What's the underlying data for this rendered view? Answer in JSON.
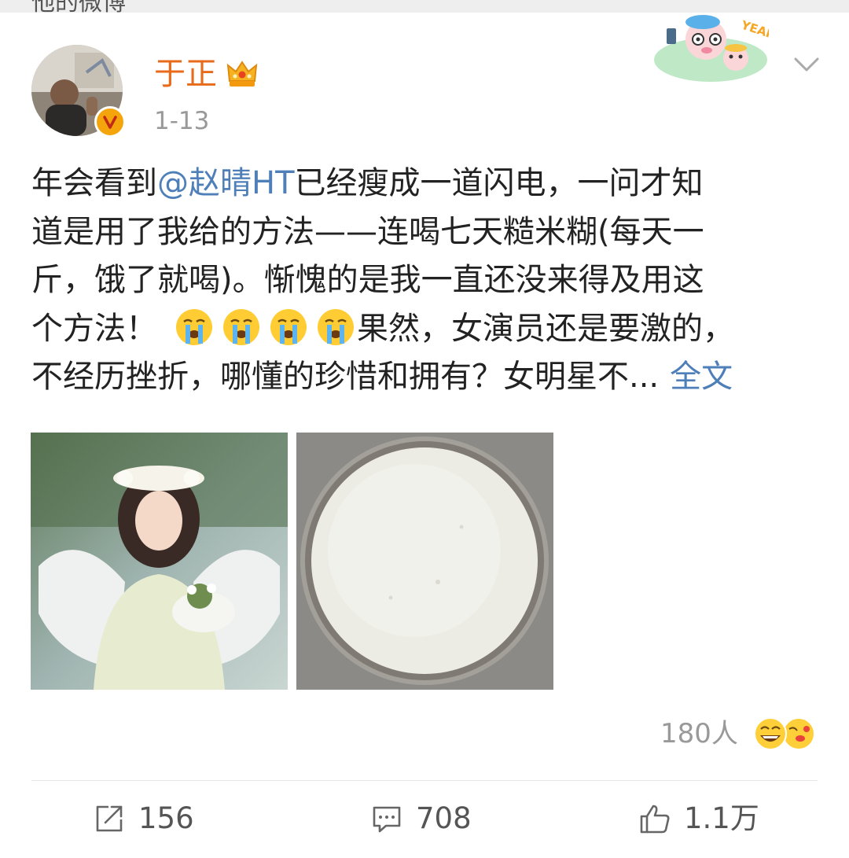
{
  "top_strip_text": "他的微博",
  "post": {
    "author": "于正",
    "time": "1-13",
    "text": {
      "l1_a": "年会看到",
      "mention": "@赵晴HT",
      "l1_b": "已经瘦成一道闪电，一问才知",
      "l2": "道是用了我给的方法——连喝七天糙米糊(每天一",
      "l3": "斤，饿了就喝)。惭愧的是我一直还没来得及用这",
      "l4_a": "个方法！",
      "l4_b": "果然，女演员还是要激的，",
      "l5": "不经历挫折，哪懂的珍惜和拥有？女明星不...",
      "full_link": "全文"
    },
    "inline_emoji": "crying-face-icon"
  },
  "reactions": {
    "count_label": "180人"
  },
  "actions": {
    "repost_count": "156",
    "comment_count": "708",
    "like_count": "1.1万"
  },
  "colors": {
    "username": "#e86b1c",
    "link": "#4e7fb8",
    "muted": "#999999",
    "badge": "#f3a50b"
  }
}
